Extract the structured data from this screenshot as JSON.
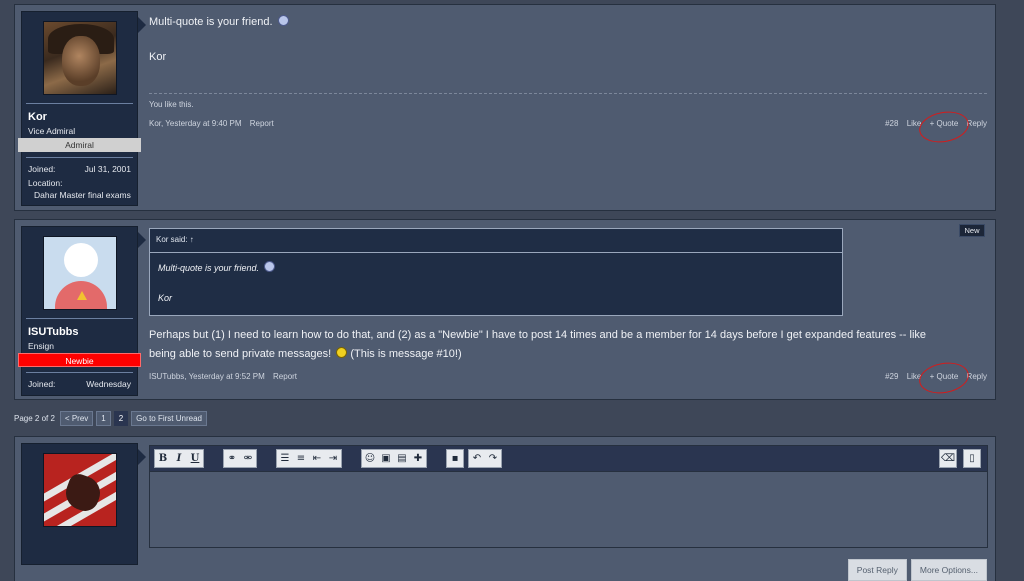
{
  "post1": {
    "username": "Kor",
    "user_title": "Vice Admiral",
    "rank": "Admiral",
    "joined_label": "Joined:",
    "joined_value": "Jul 31, 2001",
    "location_label": "Location:",
    "location_value": "Dahar Master final exams",
    "message_line1": "Multi-quote is your friend.",
    "message_line2": "Kor",
    "likes_text": "You like this.",
    "author_time": "Kor, Yesterday at 9:40 PM",
    "report": "Report",
    "post_number": "#28",
    "like": "Like",
    "quote": "+ Quote",
    "reply": "Reply"
  },
  "post2": {
    "username": "ISUTubbs",
    "user_title": "Ensign",
    "rank": "Newbie",
    "joined_label": "Joined:",
    "joined_value": "Wednesday",
    "new_tag": "New",
    "quote_header": "Kor said: ↑",
    "quote_line1": "Multi-quote is your friend.",
    "quote_line2": "Kor",
    "message_line1": "Perhaps but (1) I need to learn how to do that, and (2) as a \"Newbie\" I have to post 14 times and be a member for 14 days before I get expanded features -- like",
    "message_line2": "being able to send private messages!",
    "message_line2_tail": "(This is message #10!)",
    "author_time": "ISUTubbs, Yesterday at 9:52 PM",
    "report": "Report",
    "post_number": "#29",
    "like": "Like",
    "quote": "+ Quote",
    "reply": "Reply"
  },
  "pager": {
    "label": "Page 2 of 2",
    "prev": "< Prev",
    "page1": "1",
    "page2": "2",
    "first_unread": "Go to First Unread"
  },
  "editor": {
    "bold": "B",
    "italic": "I",
    "underline": "U",
    "post_reply": "Post Reply",
    "more_options": "More Options..."
  },
  "colors": {
    "background": "#3e4758",
    "panel": "#4f5b70",
    "userbox": "#1e2b42",
    "newbie_rank": "#ff0000",
    "annotation": "#d31c1c"
  }
}
